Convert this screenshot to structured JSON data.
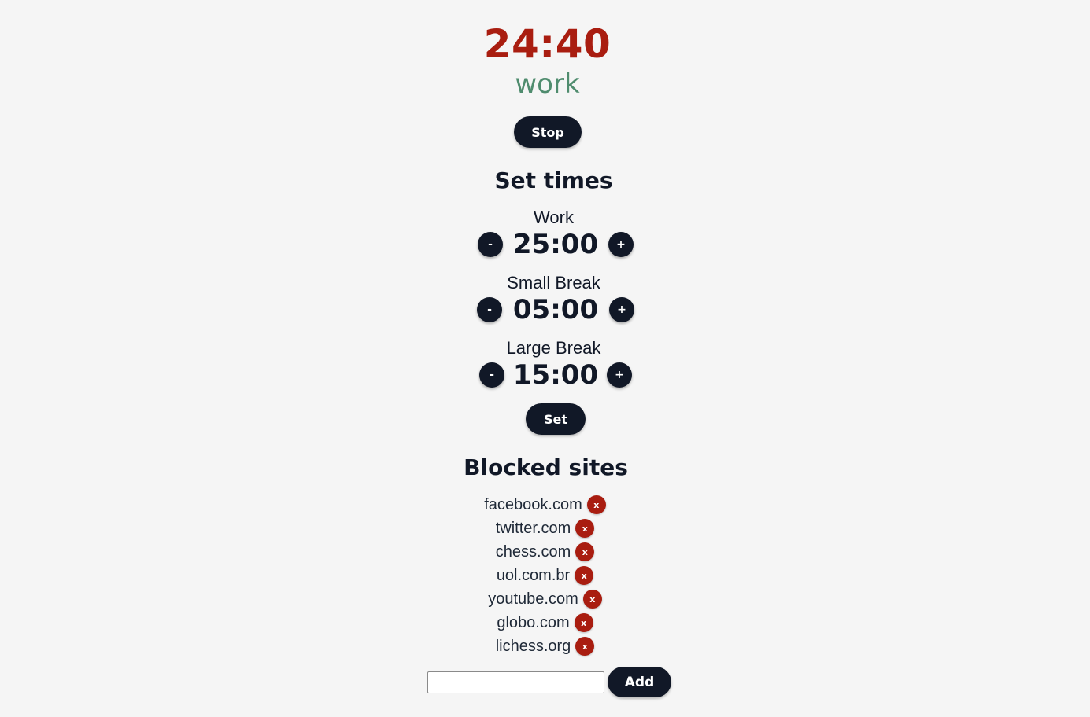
{
  "timer": {
    "display": "24:40",
    "mode": "work",
    "stop_label": "Stop"
  },
  "set_times": {
    "heading": "Set times",
    "items": [
      {
        "label": "Work",
        "value": "25:00",
        "minus": "-",
        "plus": "+"
      },
      {
        "label": "Small Break",
        "value": "05:00",
        "minus": "-",
        "plus": "+"
      },
      {
        "label": "Large Break",
        "value": "15:00",
        "minus": "-",
        "plus": "+"
      }
    ],
    "set_label": "Set"
  },
  "blocked_sites": {
    "heading": "Blocked sites",
    "remove_label": "x",
    "sites": [
      "facebook.com",
      "twitter.com",
      "chess.com",
      "uol.com.br",
      "youtube.com",
      "globo.com",
      "lichess.org"
    ],
    "input_value": "",
    "add_label": "Add"
  },
  "colors": {
    "accent_red": "#a91d10",
    "mode_green": "#4f8c6e",
    "button_dark": "#111827",
    "background": "#f5f5f5"
  }
}
